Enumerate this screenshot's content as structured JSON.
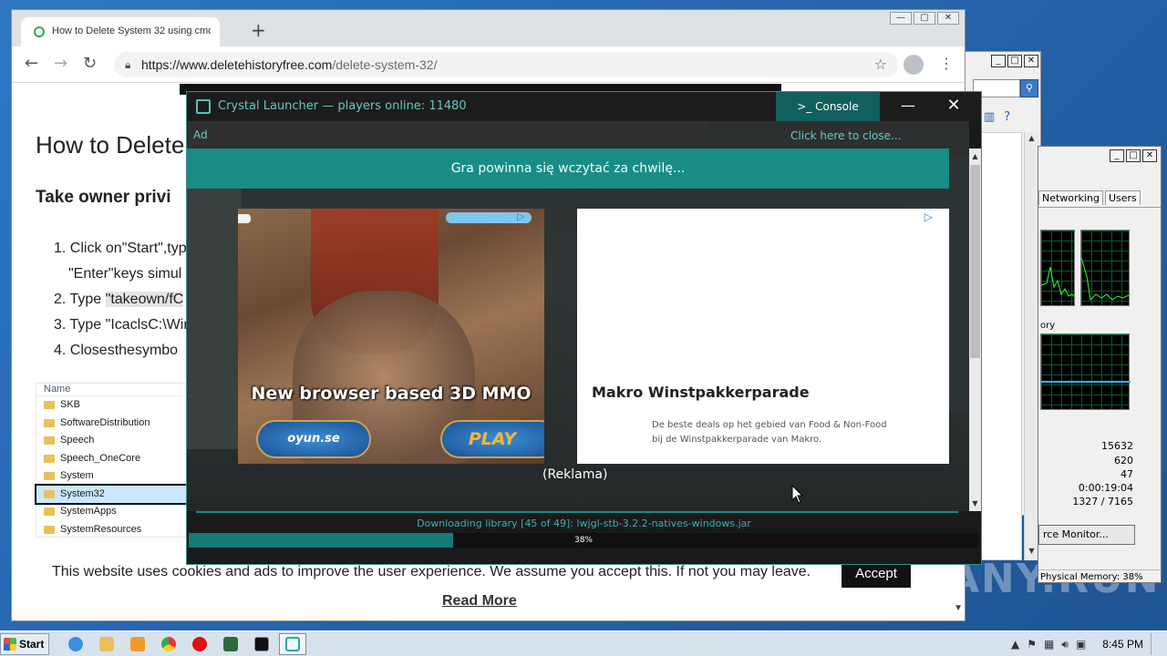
{
  "browser": {
    "tab_title": "How to Delete System 32 using cmd",
    "new_tab_label": "+",
    "url_host": "https://www.deletehistoryfree.com",
    "url_path": "/delete-system-32/",
    "window_controls": [
      "—",
      "▢",
      "✕"
    ]
  },
  "article": {
    "title": "How to Delete",
    "subtitle": "Take owner privi",
    "steps": [
      {
        "num": "1.",
        "text": "Click on\"Start\",typ"
      },
      {
        "num": "",
        "text": "\"Enter\"keys simul"
      },
      {
        "num": "2.",
        "text": "Type ",
        "highlight": "\"takeown/fC"
      },
      {
        "num": "3.",
        "text": "Type \"IcaclsC:\\Wir"
      },
      {
        "num": "4.",
        "text": " Closesthesymbo"
      }
    ],
    "explorer_header": "Name",
    "explorer_rows": [
      "SKB",
      "SoftwareDistribution",
      "Speech",
      "Speech_OneCore",
      "System",
      "System32",
      "SystemApps",
      "SystemResources"
    ],
    "explorer_selected": "System32",
    "cookie_text": "This website uses cookies and ads to improve the user experience. We assume you accept this. If not you may leave.",
    "accept_label": "Accept",
    "read_more_label": "Read More"
  },
  "launcher": {
    "title": "Crystal Launcher — players online: 11480",
    "console_label": ">_ Console",
    "minimize_label": "—",
    "close_label": "✕",
    "ad_label": "Ad",
    "ad_close_label": "Click here to close...",
    "loading_text": "Gra powinna się wczytać za chwilę...",
    "ad_left": {
      "headline": "New browser based 3D MMO",
      "brand_label": "oyun.se",
      "play_label": "PLAY"
    },
    "ad_right": {
      "headline": "Makro Winstpakkerparade",
      "description": "De beste deals op het gebied van Food & Non-Food bij de Winstpakkerparade van Makro."
    },
    "reklama": "(Reklama)",
    "download_text": "Downloading library [45 of 49]: lwjgl-stb-3.2.2-natives-windows.jar",
    "progress_pct_label": "38%",
    "progress_value": 0.38
  },
  "taskmgr": {
    "tabs": [
      "Networking",
      "Users"
    ],
    "memory_label": "ory",
    "values": [
      "15632",
      "620",
      "47",
      "0:00:19:04",
      "1327 / 7165"
    ],
    "resource_monitor_label": "rce Monitor...",
    "status_text": "Physical Memory: 38%"
  },
  "taskbar": {
    "start_label": "Start",
    "clock": "8:45 PM"
  },
  "watermark": "ANY.RUN",
  "colors": {
    "launcher_teal": "#1a8c86",
    "launcher_text": "#64c7c0",
    "chrome_tabstrip": "#dee1e6"
  }
}
